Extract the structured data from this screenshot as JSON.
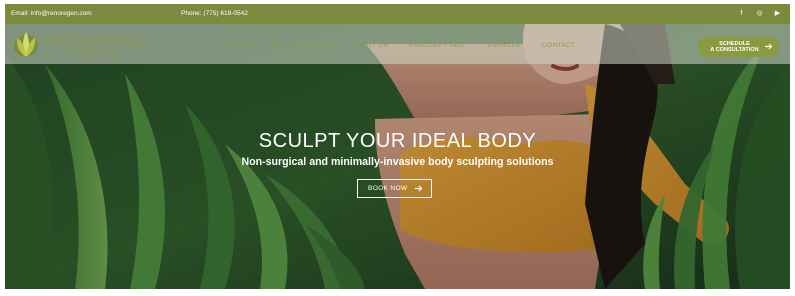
{
  "topbar": {
    "email": "Email: info@renoregen.com",
    "phone": "Phone: (775) 618-0542",
    "social": [
      {
        "icon": "facebook-icon",
        "glyph": "f"
      },
      {
        "icon": "instagram-icon",
        "glyph": "◎"
      },
      {
        "icon": "youtube-icon",
        "glyph": "▶"
      }
    ]
  },
  "logo": {
    "line1": "Reno Regenerative",
    "line2": "Medicine"
  },
  "nav": {
    "items": [
      {
        "label": "HOME"
      },
      {
        "label": "(775) 618-0542"
      },
      {
        "label": "ABOUT US"
      },
      {
        "label": "EMSCULPT NEO"
      },
      {
        "label": "EMSELLA"
      },
      {
        "label": "CONTACT"
      }
    ],
    "cta_line1": "SCHEDULE",
    "cta_line2": "A CONSULTATION"
  },
  "hero": {
    "headline": "SCULPT YOUR IDEAL BODY",
    "subline": "Non-surgical and minimally-invasive body sculpting solutions",
    "button_label": "BOOK NOW"
  },
  "colors": {
    "brand_green": "#7b8a3c",
    "cta_green": "#8a9a3e",
    "top_green_text": "#8c9a4b"
  }
}
